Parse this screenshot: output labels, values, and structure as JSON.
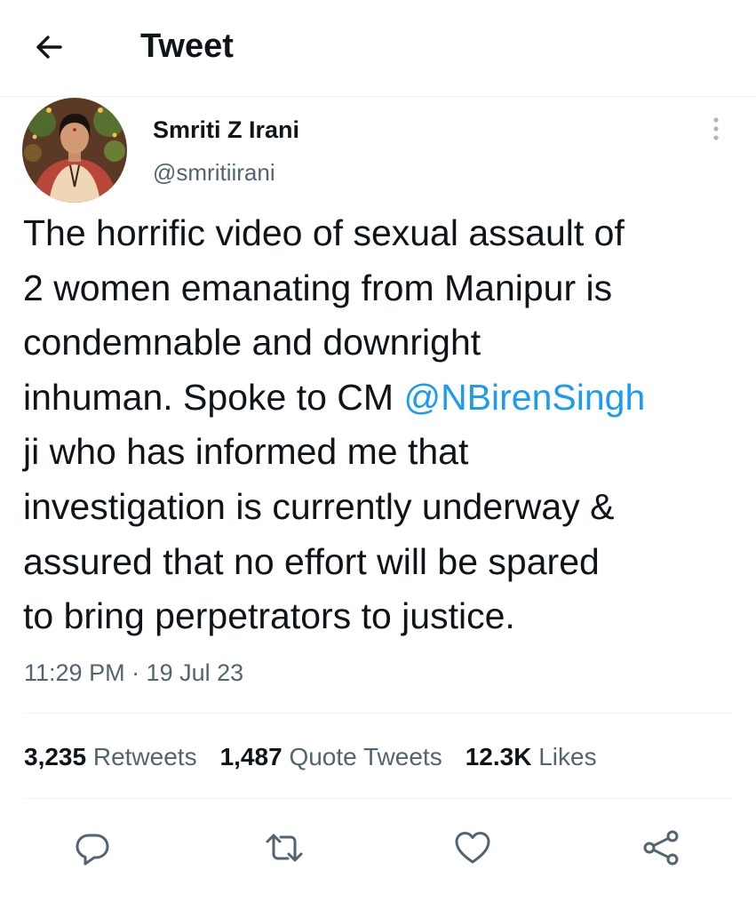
{
  "header": {
    "title": "Tweet",
    "back_icon": "arrow-left-icon"
  },
  "tweet": {
    "author_name": "Smriti Z Irani",
    "author_handle": "@smritiirani",
    "more_icon": "more-vertical-icon",
    "text": {
      "line1": "The horrific video of sexual assault of",
      "line2": "2 women emanating from Manipur is",
      "line3": "condemnable and downright",
      "line4_prefix": "inhuman. Spoke to CM ",
      "mention": "@NBirenSingh",
      "line5": "ji who has informed me that",
      "line6": "investigation is currently underway &",
      "line7": "assured that no effort will be spared",
      "line8": "to bring perpetrators to justice."
    },
    "timestamp": "11:29 PM · 19 Jul 23",
    "stats": {
      "retweets_count": "3,235",
      "retweets_label": "Retweets",
      "quotes_count": "1,487",
      "quotes_label": "Quote Tweets",
      "likes_count": "12.3K",
      "likes_label": "Likes"
    },
    "actions": [
      "reply-icon",
      "retweet-icon",
      "like-icon",
      "share-icon"
    ]
  },
  "colors": {
    "text": "#0f1419",
    "secondary": "#536471",
    "link": "#1d9bf0",
    "divider": "#eff3f4"
  }
}
